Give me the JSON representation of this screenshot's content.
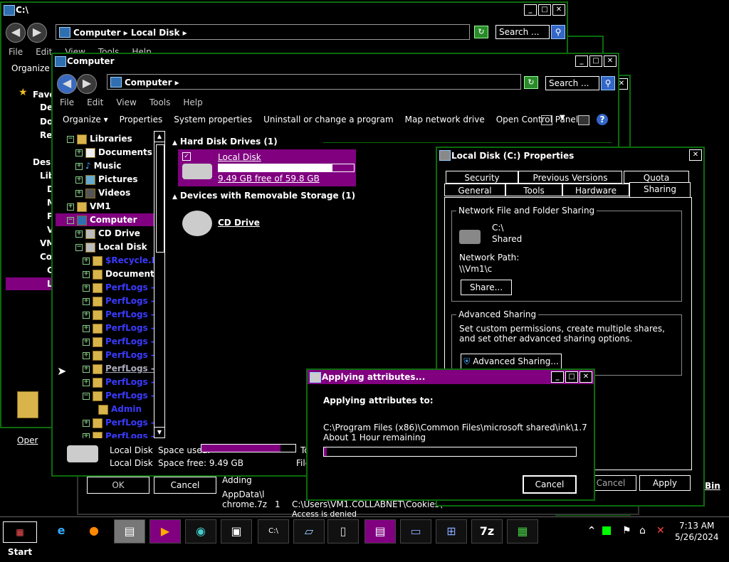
{
  "back_window": {
    "title": "C:\\",
    "address": "Computer ▸ Local Disk ▸",
    "search_placeholder": "Search ...",
    "menu": [
      "File",
      "Edit",
      "View",
      "Tools",
      "Help"
    ],
    "organize": "Organize",
    "tree": [
      "Favo",
      "Des",
      "Dov",
      "Rec",
      "Desk",
      "Libr",
      "D",
      "M",
      "P",
      "V",
      "VM",
      "Con",
      "C",
      "L"
    ],
    "open_label": "Oper"
  },
  "main_window": {
    "title": "Computer",
    "address": "Computer ▸",
    "search_placeholder": "Search ...",
    "menu": [
      "File",
      "Edit",
      "View",
      "Tools",
      "Help"
    ],
    "toolbar": [
      "Organize ▾",
      "Properties",
      "System properties",
      "Uninstall or change a program",
      "Map network drive",
      "Open Control Panel"
    ],
    "tree": [
      {
        "label": "Libraries",
        "style": "white"
      },
      {
        "label": "Documents",
        "style": "white"
      },
      {
        "label": "Music",
        "style": "white"
      },
      {
        "label": "Pictures",
        "style": "white"
      },
      {
        "label": "Videos",
        "style": "white"
      },
      {
        "label": "VM1",
        "style": "white"
      },
      {
        "label": "Computer",
        "style": "selected"
      },
      {
        "label": "CD Drive",
        "style": "white"
      },
      {
        "label": "Local Disk",
        "style": "white"
      },
      {
        "label": "$Recycle.Bi",
        "style": "blue"
      },
      {
        "label": "Documents",
        "style": "white"
      },
      {
        "label": "PerfLogs - ",
        "style": "blue"
      },
      {
        "label": "PerfLogs - ",
        "style": "blue"
      },
      {
        "label": "PerfLogs - ",
        "style": "blue"
      },
      {
        "label": "PerfLogs - ",
        "style": "blue"
      },
      {
        "label": "PerfLogs - ",
        "style": "blue"
      },
      {
        "label": "PerfLogs - ",
        "style": "blue"
      },
      {
        "label": "PerfLogs - ",
        "style": "underline"
      },
      {
        "label": "PerfLogs - ",
        "style": "blue"
      },
      {
        "label": "PerfLogs - ",
        "style": "blue"
      },
      {
        "label": "Admin",
        "style": "blue"
      },
      {
        "label": "PerfLogs - ",
        "style": "blue"
      },
      {
        "label": "PerfLogs - ",
        "style": "blue"
      }
    ],
    "hard_disk_header": "Hard Disk Drives (1)",
    "local_disk_name": "Local Disk",
    "local_disk_free": "9.49 GB free of 59.8 GB",
    "local_disk_used_fraction": 0.84,
    "removable_header": "Devices with Removable Storage (1)",
    "cd_drive_name": "CD Drive",
    "status": {
      "name": "Local Disk",
      "space_used_label": "Space used:",
      "type": "Local Disk",
      "space_free": "Space free: 9.49 GB",
      "trunc1": "To",
      "trunc2": "File"
    }
  },
  "properties_dialog": {
    "title": "Local Disk (C:) Properties",
    "tabs_row1": [
      "Security",
      "Previous Versions",
      "Quota"
    ],
    "tabs_row2": [
      "General",
      "Tools",
      "Hardware",
      "Sharing"
    ],
    "network_group": "Network File and Folder Sharing",
    "path_name": "C:\\",
    "path_status": "Shared",
    "network_path_label": "Network Path:",
    "network_path": "\\\\Vm1\\c",
    "share_button": "Share...",
    "advanced_group": "Advanced Sharing",
    "advanced_desc": "Set custom permissions, create multiple shares, and set other advanced sharing options.",
    "advanced_button": "Advanced Sharing...",
    "cancel_button": "Cancel",
    "apply_button": "Apply",
    "bin_label": "Bin"
  },
  "attr_dialog": {
    "title": "Applying attributes...",
    "heading": "Applying attributes to:",
    "path": "C:\\Program Files (x86)\\Common Files\\microsoft shared\\ink\\1.7",
    "remaining": "About 1 Hour remaining",
    "progress_fraction": 0.01,
    "cancel_button": "Cancel"
  },
  "background_dialog": {
    "ok_button": "OK",
    "cancel_button": "Cancel",
    "adding": "Adding",
    "appdata": "AppData\\l",
    "chrome": "chrome.7z",
    "row_num": "1",
    "row_path": "C:\\Users\\VM1.COLLABNET\\Cookies\\",
    "access": "Access is denied"
  },
  "taskbar": {
    "start": "Start",
    "time": "7:13 AM",
    "date": "5/26/2024",
    "show_hidden": "^",
    "app_7z": "7z"
  }
}
